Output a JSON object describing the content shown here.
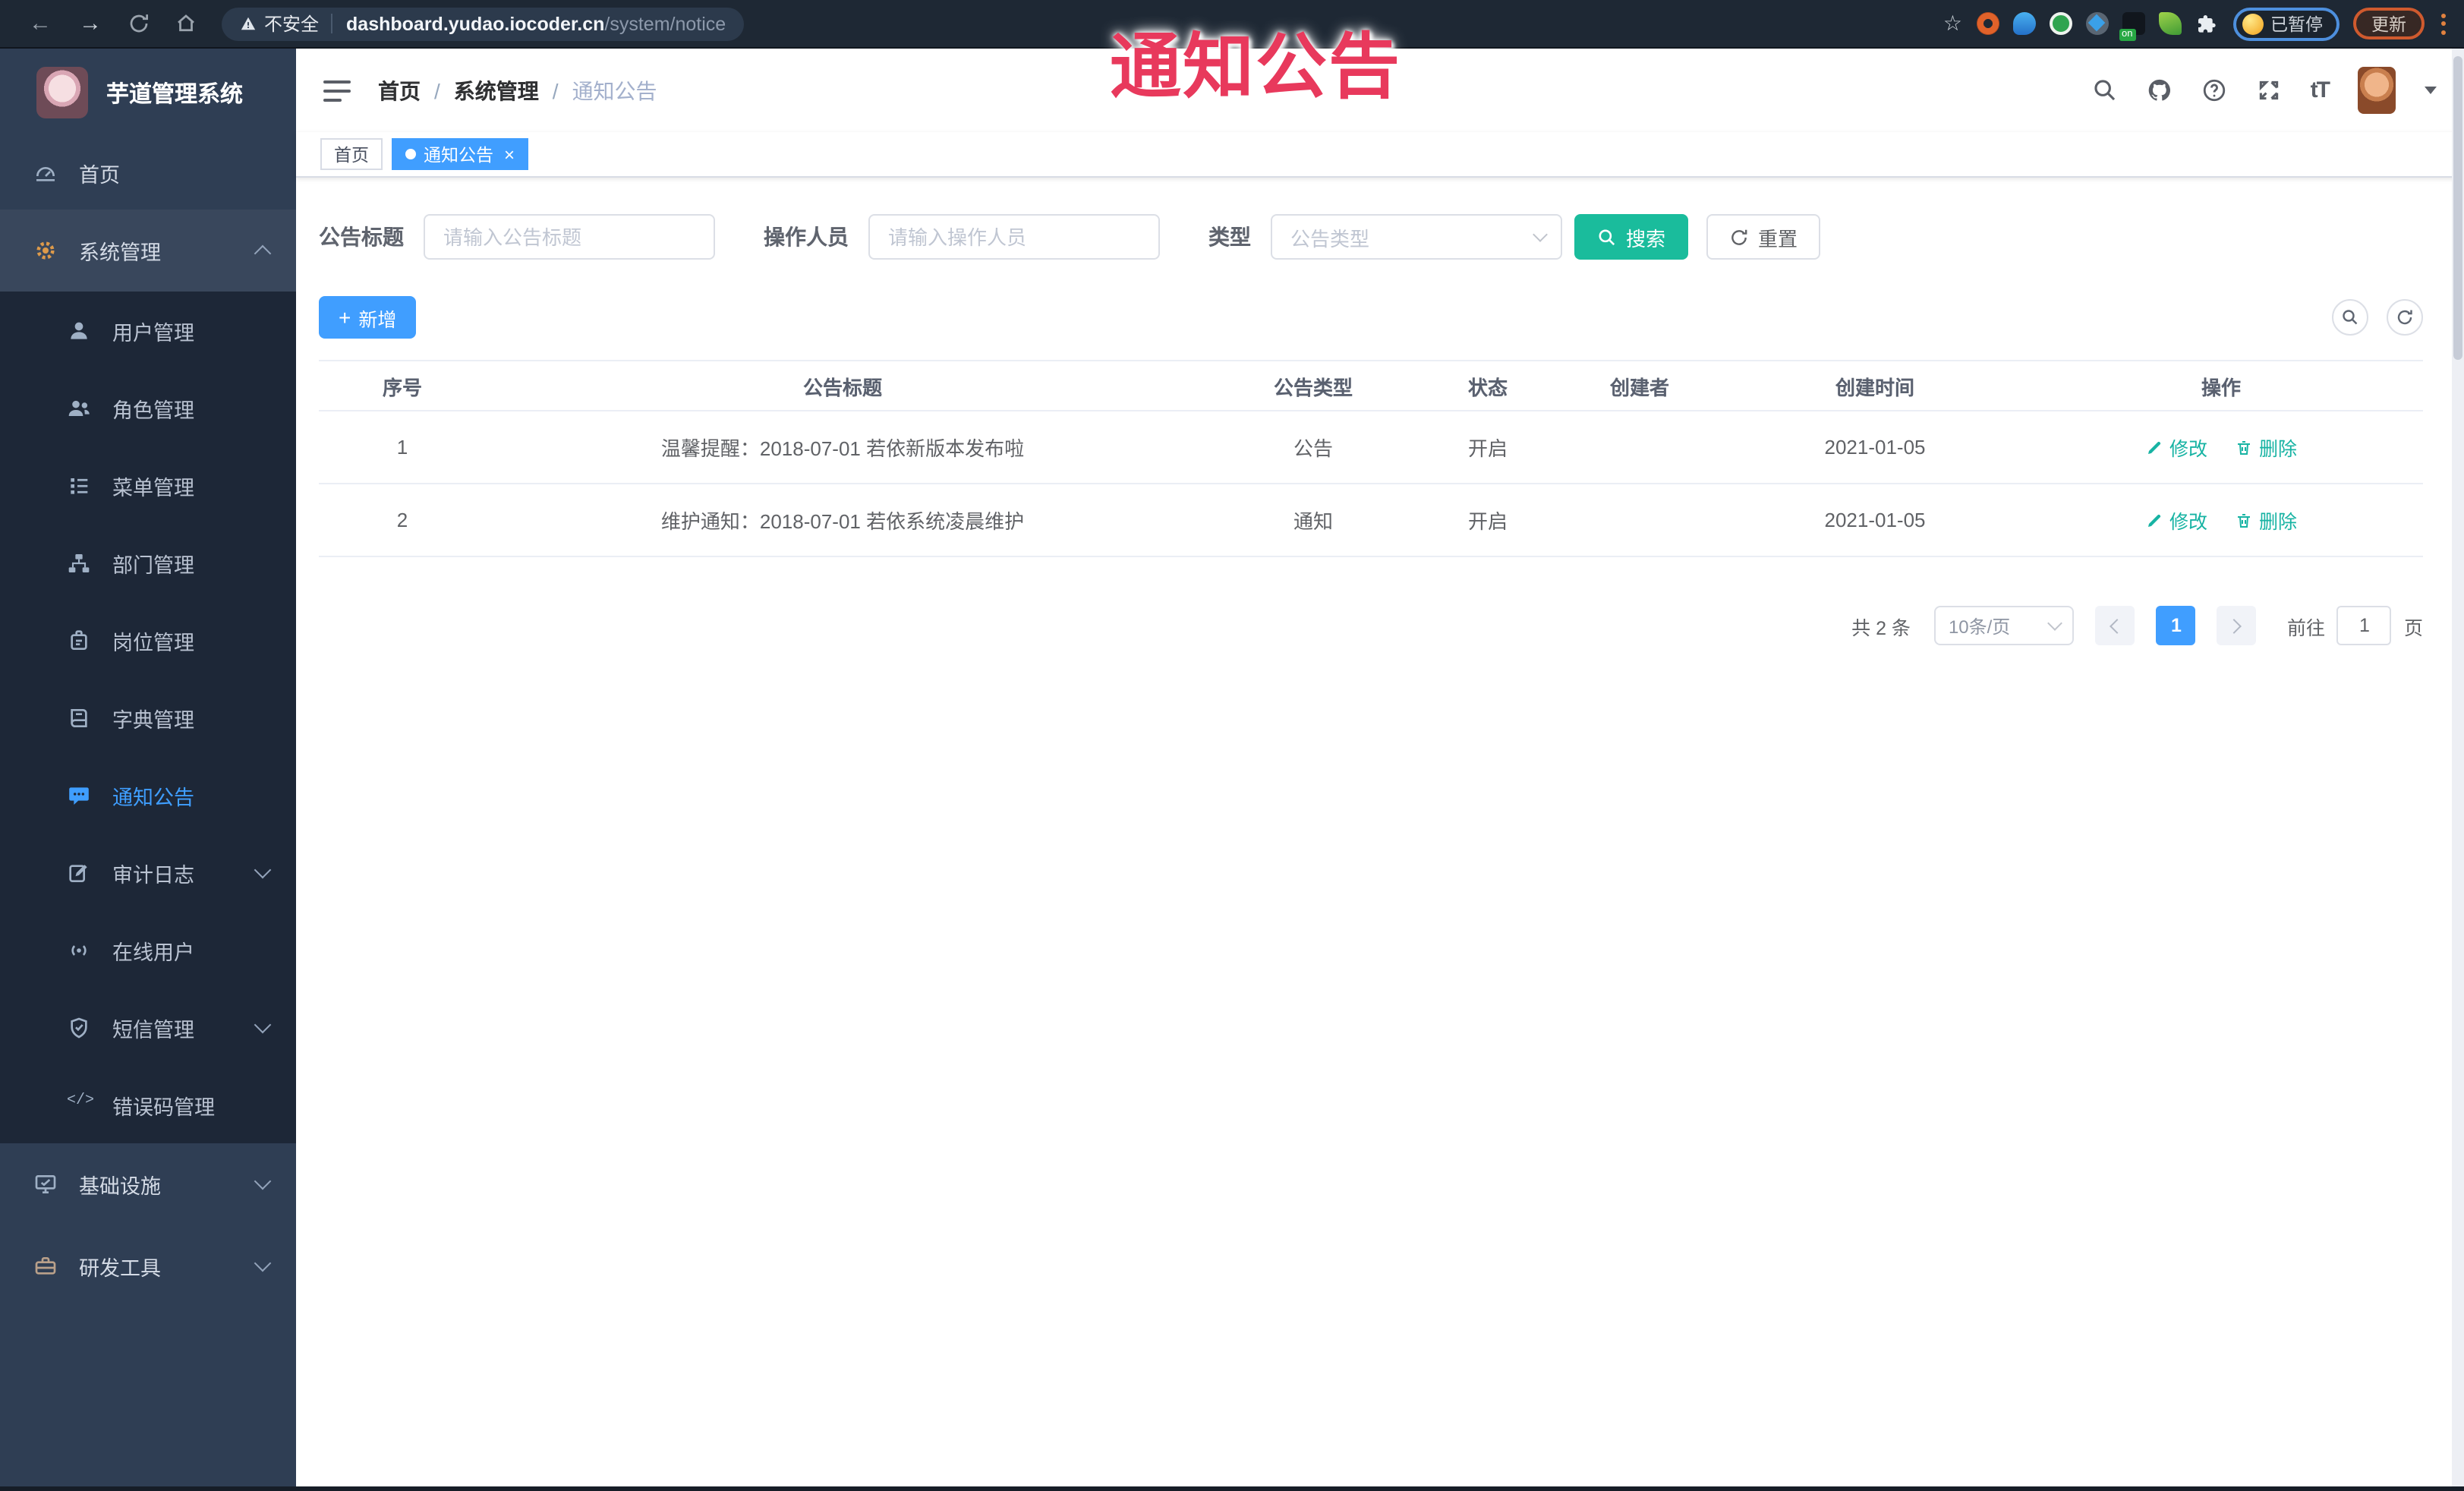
{
  "browser": {
    "security_label": "不安全",
    "url_domain": "dashboard.yudao.iocoder.cn",
    "url_path": "/system/notice",
    "extension_badge_label": "on",
    "profile_status": "已暂停",
    "update_label": "更新"
  },
  "overlay": {
    "title": "通知公告",
    "color": "#e8395c"
  },
  "sidebar": {
    "logo_title": "芋道管理系统",
    "items": [
      {
        "label": "首页"
      },
      {
        "label": "系统管理",
        "expanded": true
      },
      {
        "label": "用户管理"
      },
      {
        "label": "角色管理"
      },
      {
        "label": "菜单管理"
      },
      {
        "label": "部门管理"
      },
      {
        "label": "岗位管理"
      },
      {
        "label": "字典管理"
      },
      {
        "label": "通知公告",
        "active": true
      },
      {
        "label": "审计日志",
        "collapsible": true
      },
      {
        "label": "在线用户"
      },
      {
        "label": "短信管理",
        "collapsible": true
      },
      {
        "label": "错误码管理"
      },
      {
        "label": "基础设施",
        "collapsible": true
      },
      {
        "label": "研发工具",
        "collapsible": true
      }
    ]
  },
  "header": {
    "breadcrumb": [
      "首页",
      "系统管理",
      "通知公告"
    ],
    "font_icon_text": "tT"
  },
  "tabs": [
    {
      "label": "首页",
      "active": false
    },
    {
      "label": "通知公告",
      "active": true
    }
  ],
  "filters": {
    "title_label": "公告标题",
    "title_placeholder": "请输入公告标题",
    "operator_label": "操作人员",
    "operator_placeholder": "请输入操作人员",
    "type_label": "类型",
    "type_placeholder": "公告类型",
    "search_label": "搜索",
    "reset_label": "重置"
  },
  "toolbar": {
    "add_label": "新增"
  },
  "table": {
    "columns": [
      "序号",
      "公告标题",
      "公告类型",
      "状态",
      "创建者",
      "创建时间",
      "操作"
    ],
    "rows": [
      {
        "no": "1",
        "title": "温馨提醒：2018-07-01 若依新版本发布啦",
        "type": "公告",
        "status": "开启",
        "creator": "",
        "created": "2021-01-05"
      },
      {
        "no": "2",
        "title": "维护通知：2018-07-01 若依系统凌晨维护",
        "type": "通知",
        "status": "开启",
        "creator": "",
        "created": "2021-01-05"
      }
    ],
    "edit_label": "修改",
    "delete_label": "删除"
  },
  "pagination": {
    "total_label": "共 2 条",
    "page_size_label": "10条/页",
    "current_page": "1",
    "goto_label": "前往",
    "goto_value": "1",
    "page_unit": "页"
  },
  "colors": {
    "accent_blue": "#409eff",
    "search_teal": "#1abc9c",
    "action_link_teal": "#17b3a3",
    "sidebar_bg": "#2f3e54",
    "submenu_bg": "#1d2737",
    "browser_bar_bg": "#1e2834",
    "overlay_red": "#e8395c"
  }
}
